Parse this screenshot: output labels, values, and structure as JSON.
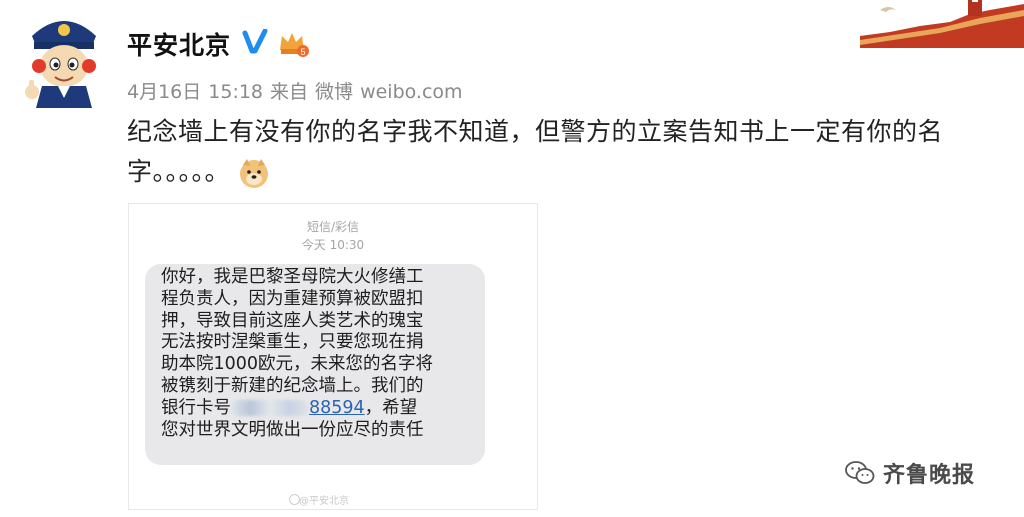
{
  "post": {
    "username": "平安北京",
    "verified_icon": "verified-v-icon",
    "vip_icon": "crown-vip-icon",
    "vip_level": "5",
    "date": "4月16日",
    "time": "15:18",
    "source_prefix": "来自",
    "source_app": "微博",
    "source_site": "weibo.com",
    "text_line1": "纪念墙上有没有你的名字我不知道，但警方的立案告知书上一定有你的名",
    "text_line2": "字。。。。。"
  },
  "sms": {
    "type_label": "短信/彩信",
    "timestamp": "今天 10:30",
    "lines": [
      "你好，我是巴黎圣母院大火修缮工",
      "程负责人，因为重建预算被欧盟扣",
      "押，导致目前这座人类艺术的瑰宝",
      "无法按时涅槃重生，只要您现在捐",
      "助本院1000欧元，未来您的名字将",
      "被镌刻于新建的纪念墙上。我们的"
    ],
    "bank_prefix": "银行卡号",
    "bank_visible": "88594",
    "bank_suffix": "，希望",
    "last_line": "您对世界文明做出一份应尽的责任",
    "watermark": "@平安北京"
  },
  "brand": {
    "name": "齐鲁晚报",
    "icon": "wechat-icon"
  },
  "colors": {
    "meta_gray": "#8a8a8a",
    "verified_blue": "#1f8cf0",
    "bubble_gray": "#e8e8ea",
    "link_blue": "#2a63b3"
  }
}
